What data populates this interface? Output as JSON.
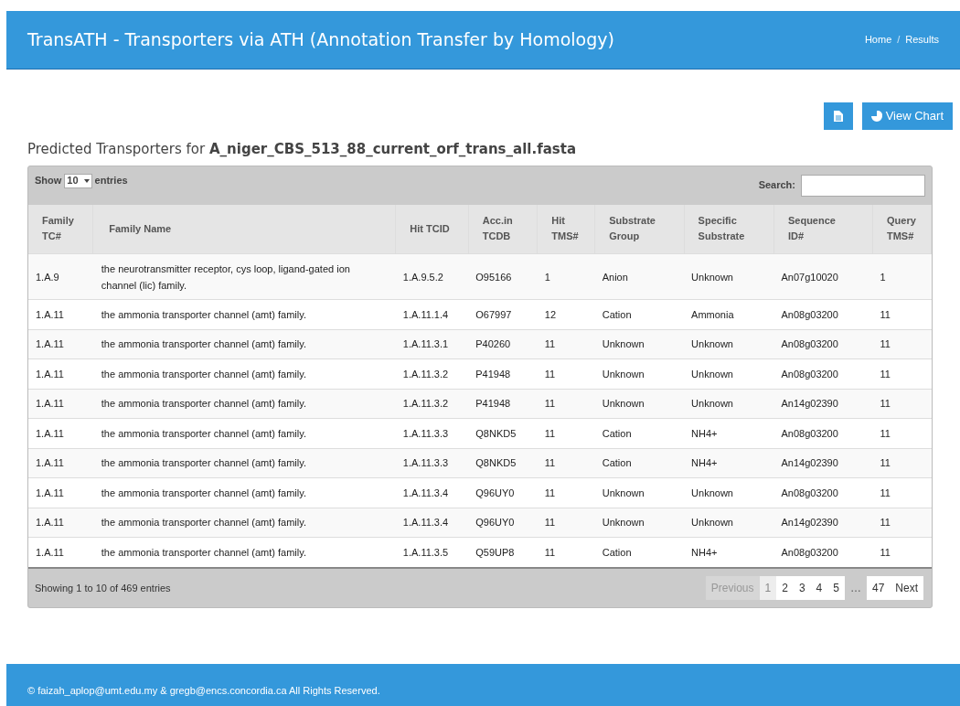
{
  "header": {
    "title": "TransATH - Transporters via ATH (Annotation Transfer by Homology)",
    "breadcrumb": [
      "Home",
      "Results"
    ],
    "separator": "/"
  },
  "actions": {
    "chart_button": "View Chart"
  },
  "heading": {
    "prefix": "Predicted Transporters for",
    "file": "A_niger_CBS_513_88_current_orf_trans_all.fasta"
  },
  "controls": {
    "show_label": "Show",
    "page_size": "10",
    "entries_label": "entries",
    "search_label": "Search:"
  },
  "table": {
    "columns": [
      "Family TC#",
      "Family Name",
      "Hit TCID",
      "Acc.in TCDB",
      "Hit TMS#",
      "Substrate Group",
      "Specific Substrate",
      "Sequence ID#",
      "Query TMS#"
    ],
    "rows": [
      [
        "1.A.9",
        "the neurotransmitter receptor, cys loop, ligand-gated ion channel (lic) family.",
        "1.A.9.5.2",
        "O95166",
        "1",
        "Anion",
        "Unknown",
        "An07g10020",
        "1"
      ],
      [
        "1.A.11",
        "the ammonia transporter channel (amt) family.",
        "1.A.11.1.4",
        "O67997",
        "12",
        "Cation",
        "Ammonia",
        "An08g03200",
        "11"
      ],
      [
        "1.A.11",
        "the ammonia transporter channel (amt) family.",
        "1.A.11.3.1",
        "P40260",
        "11",
        "Unknown",
        "Unknown",
        "An08g03200",
        "11"
      ],
      [
        "1.A.11",
        "the ammonia transporter channel (amt) family.",
        "1.A.11.3.2",
        "P41948",
        "11",
        "Unknown",
        "Unknown",
        "An08g03200",
        "11"
      ],
      [
        "1.A.11",
        "the ammonia transporter channel (amt) family.",
        "1.A.11.3.2",
        "P41948",
        "11",
        "Unknown",
        "Unknown",
        "An14g02390",
        "11"
      ],
      [
        "1.A.11",
        "the ammonia transporter channel (amt) family.",
        "1.A.11.3.3",
        "Q8NKD5",
        "11",
        "Cation",
        "NH4+",
        "An08g03200",
        "11"
      ],
      [
        "1.A.11",
        "the ammonia transporter channel (amt) family.",
        "1.A.11.3.3",
        "Q8NKD5",
        "11",
        "Cation",
        "NH4+",
        "An14g02390",
        "11"
      ],
      [
        "1.A.11",
        "the ammonia transporter channel (amt) family.",
        "1.A.11.3.4",
        "Q96UY0",
        "11",
        "Unknown",
        "Unknown",
        "An08g03200",
        "11"
      ],
      [
        "1.A.11",
        "the ammonia transporter channel (amt) family.",
        "1.A.11.3.4",
        "Q96UY0",
        "11",
        "Unknown",
        "Unknown",
        "An14g02390",
        "11"
      ],
      [
        "1.A.11",
        "the ammonia transporter channel (amt) family.",
        "1.A.11.3.5",
        "Q59UP8",
        "11",
        "Cation",
        "NH4+",
        "An08g03200",
        "11"
      ]
    ]
  },
  "info": "Showing 1 to 10 of 469 entries",
  "pagination": [
    {
      "label": "Previous",
      "selected": false,
      "disabled": true
    },
    {
      "label": "1",
      "selected": true,
      "disabled": false
    },
    {
      "label": "2",
      "selected": false,
      "disabled": false
    },
    {
      "label": "3",
      "selected": false,
      "disabled": false
    },
    {
      "label": "4",
      "selected": false,
      "disabled": false
    },
    {
      "label": "5",
      "selected": false,
      "disabled": false
    },
    {
      "label": "…",
      "selected": false,
      "disabled": true,
      "kind": "ellipsis"
    },
    {
      "label": "47",
      "selected": false,
      "disabled": false
    },
    {
      "label": "Next",
      "selected": false,
      "disabled": false
    }
  ],
  "footer": "© faizah_aplop@umt.edu.my & gregb@encs.concordia.ca All Rights Reserved."
}
